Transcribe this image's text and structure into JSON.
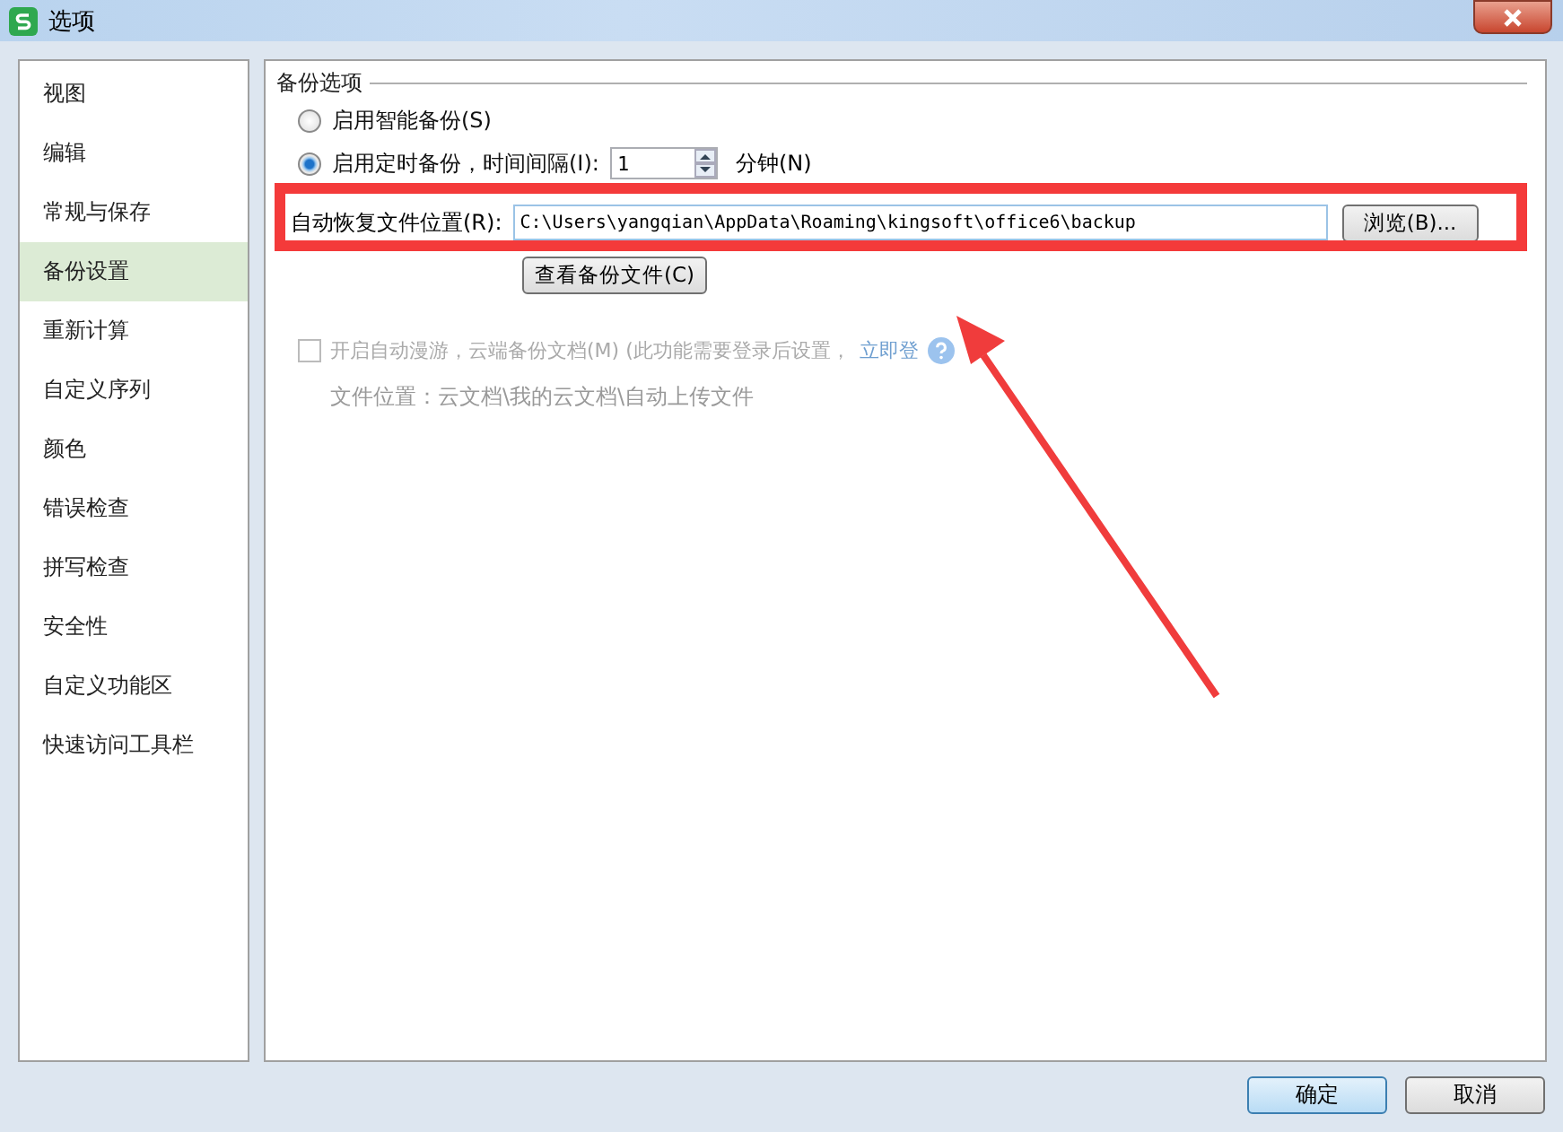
{
  "window": {
    "title": "选项"
  },
  "sidebar": {
    "items": [
      {
        "label": "视图",
        "selected": false
      },
      {
        "label": "编辑",
        "selected": false
      },
      {
        "label": "常规与保存",
        "selected": false
      },
      {
        "label": "备份设置",
        "selected": true
      },
      {
        "label": "重新计算",
        "selected": false
      },
      {
        "label": "自定义序列",
        "selected": false
      },
      {
        "label": "颜色",
        "selected": false
      },
      {
        "label": "错误检查",
        "selected": false
      },
      {
        "label": "拼写检查",
        "selected": false
      },
      {
        "label": "安全性",
        "selected": false
      },
      {
        "label": "自定义功能区",
        "selected": false
      },
      {
        "label": "快速访问工具栏",
        "selected": false
      }
    ]
  },
  "backup": {
    "title": "备份选项",
    "options": [
      {
        "label": "启用智能备份(S)",
        "selected": false
      },
      {
        "label": "启用定时备份，时间间隔(I):",
        "selected": true
      }
    ],
    "interval": {
      "value": "1",
      "unit": "分钟(N)"
    },
    "path": {
      "label": "自动恢复文件位置(R):",
      "value": "C:\\Users\\yangqian\\AppData\\Roaming\\kingsoft\\office6\\backup",
      "button": "浏览(B)..."
    },
    "view_button": "查看备份文件(C)"
  },
  "cloud": {
    "label": "开启自动漫游，云端备份文档(M) (此功能需要登录后设置，",
    "link": "立即登",
    "checked": false,
    "disabled": true,
    "location": "文件位置：云文档\\我的云文档\\自动上传文件"
  },
  "footer": {
    "buttons": [
      {
        "label": "确定",
        "default": true
      },
      {
        "label": "取消",
        "default": false
      }
    ]
  }
}
